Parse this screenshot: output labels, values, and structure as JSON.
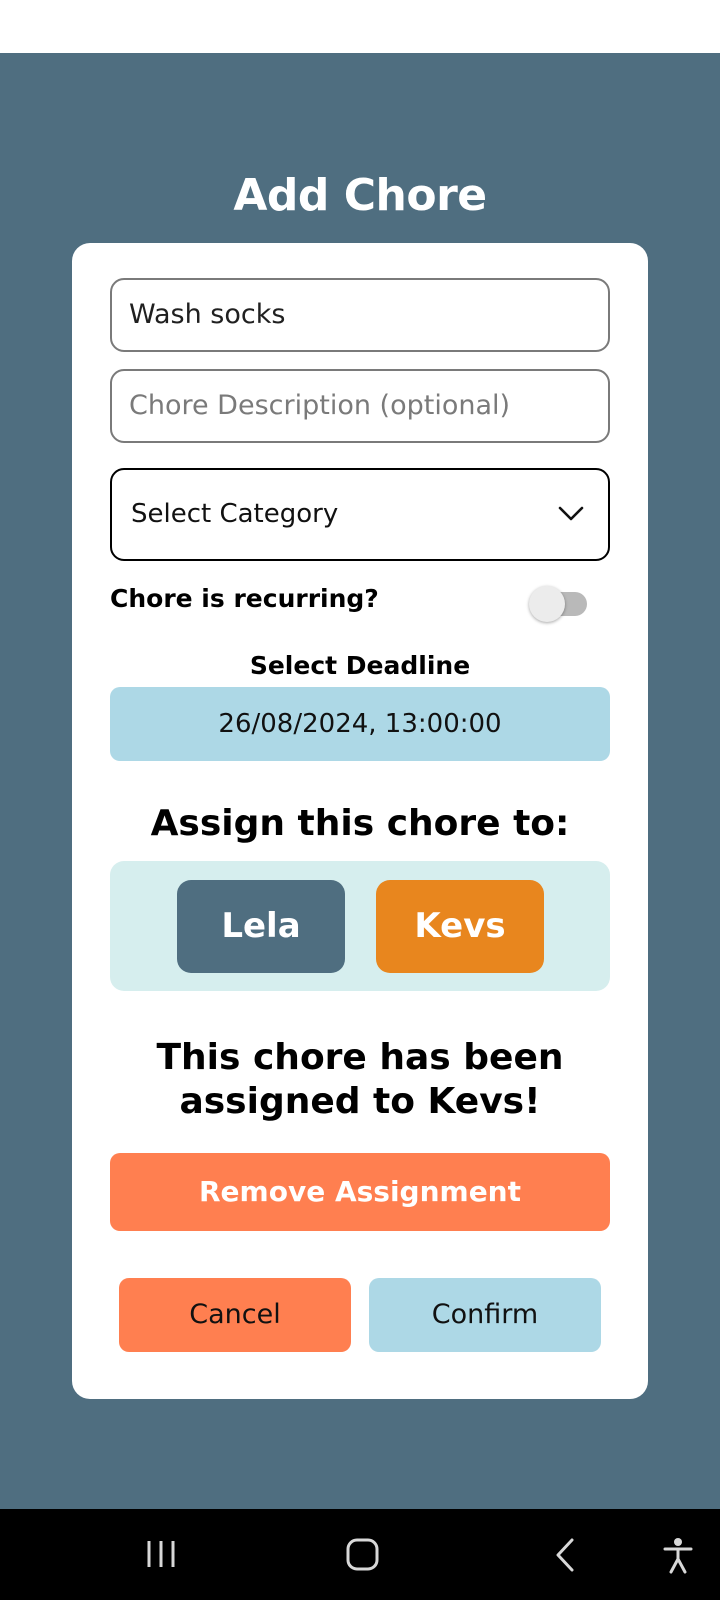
{
  "page": {
    "title": "Add Chore"
  },
  "form": {
    "chore_name_value": "Wash socks",
    "description_placeholder": "Chore Description (optional)",
    "category_selected": "Select Category",
    "recurring_label": "Chore is recurring?",
    "recurring_on": false,
    "deadline_label": "Select Deadline",
    "deadline_value": "26/08/2024, 13:00:00"
  },
  "assign": {
    "heading": "Assign this chore to:",
    "people": [
      "Lela",
      "Kevs"
    ],
    "selected": "Kevs",
    "assigned_message": "This chore has been assigned to Kevs!",
    "remove_label": "Remove Assignment"
  },
  "actions": {
    "cancel_label": "Cancel",
    "confirm_label": "Confirm"
  },
  "colors": {
    "background": "#4f6e80",
    "card": "#ffffff",
    "deadline_bg": "#add8e6",
    "assign_box_bg": "#d6eeee",
    "person_default": "#4f6e80",
    "person_selected": "#e8861e",
    "remove_button": "#ff7f50",
    "cancel_button": "#ff7f50",
    "confirm_button": "#add8e6"
  },
  "navbar": {
    "icons": [
      "recent-apps-icon",
      "home-icon",
      "back-icon",
      "accessibility-icon"
    ]
  }
}
